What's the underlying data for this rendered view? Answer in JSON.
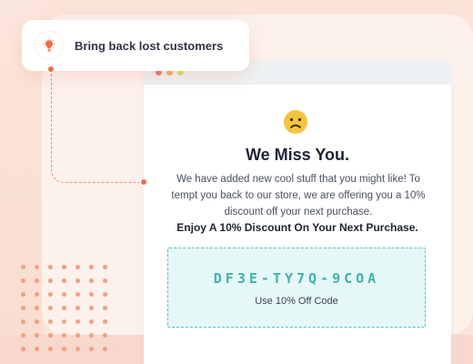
{
  "tooltip": {
    "label": "Bring back lost customers",
    "icon": "lightbulb-icon"
  },
  "window": {
    "controls": [
      "close-dot",
      "minimize-dot",
      "maximize-dot"
    ]
  },
  "email": {
    "emoji": "sad-face-icon",
    "headline": "We Miss You.",
    "body": "We have added new cool stuff that you might like! To tempt you back to our store, we are offering you a 10% discount off your next purchase.",
    "offer": "Enjoy A 10% Discount On Your Next Purchase.",
    "coupon_code": "DF3E-TY7Q-9COA",
    "coupon_caption": "Use 10% Off Code"
  },
  "colors": {
    "background": "#fbe3d9",
    "accent": "#f26c46",
    "coupon_teal": "#3fb2ae",
    "coupon_bg": "#e6f7f7",
    "emoji_yellow": "#f6c33e"
  }
}
